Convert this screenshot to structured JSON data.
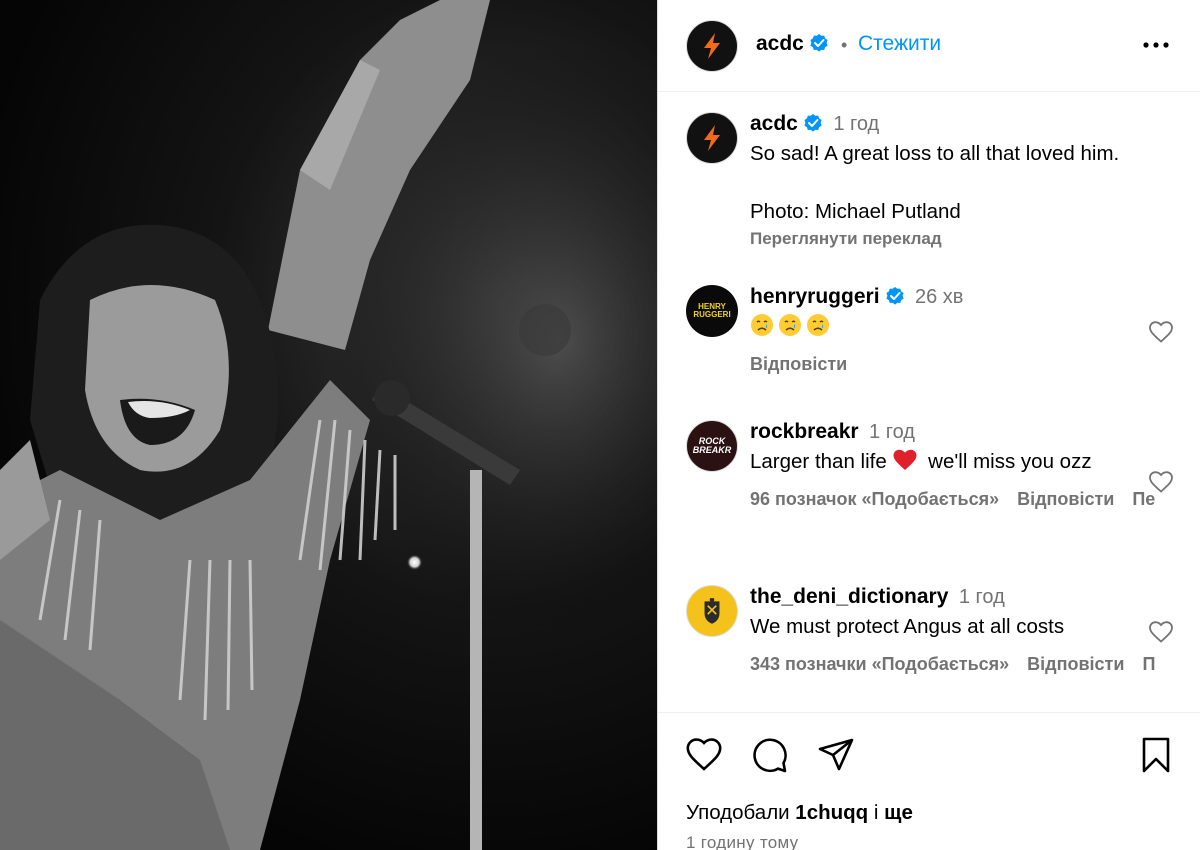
{
  "photo": {
    "icon": "concert-photo-bw"
  },
  "header": {
    "username": "acdc",
    "separator": "•",
    "follow_label": "Стежити",
    "more_icon": "more-horizontal-icon"
  },
  "caption": {
    "username": "acdc",
    "time": "1 год",
    "line1": "So sad! A great loss to all that loved him.",
    "line2": "Photo: Michael Putland",
    "translate_label": "Переглянути переклад"
  },
  "comments": [
    {
      "username": "henryruggeri",
      "verified": true,
      "time": "26 хв",
      "text": "",
      "emoji_count": 3,
      "avatar_text_1": "HENRY",
      "avatar_text_2": "RUGGERI",
      "likes_label": "",
      "reply_label": "Відповісти"
    },
    {
      "username": "rockbreakr",
      "verified": false,
      "time": "1 год",
      "text_before": "Larger than life",
      "text_after": "we'll miss you ozz",
      "avatar_text_1": "ROCK",
      "avatar_text_2": "BREAKR",
      "likes_label": "96 позначок «Подобається»",
      "reply_label": "Відповісти",
      "overflow_label": "Пе"
    },
    {
      "username": "the_deni_dictionary",
      "verified": false,
      "time": "1 год",
      "text": "We must protect Angus at all costs",
      "likes_label": "343 позначки «Подобається»",
      "reply_label": "Відповісти",
      "overflow_label": "П"
    }
  ],
  "footer": {
    "liked_prefix": "Уподобали ",
    "liked_user": "1chuqq",
    "liked_middle": " і ",
    "liked_suffix": "ще",
    "posted_time": "1 годину тому"
  },
  "colors": {
    "link": "#0095f6",
    "muted": "#737373",
    "verified": "#0095f6",
    "heart_red": "#e0202b"
  }
}
